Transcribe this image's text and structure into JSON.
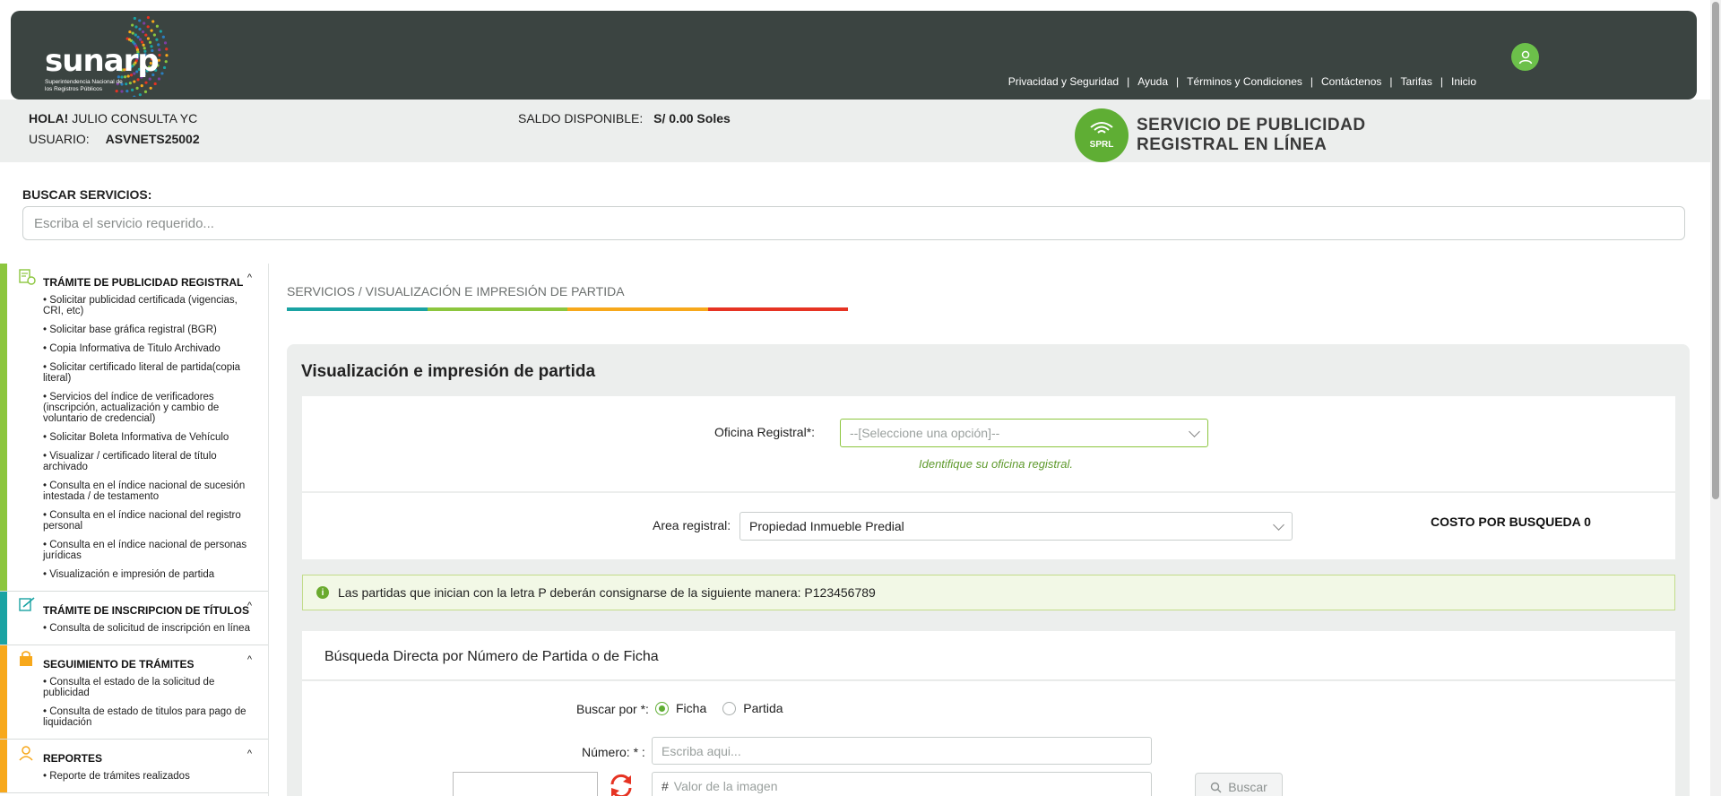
{
  "header": {
    "logo_text": "sunarp",
    "logo_subtitle": "Superintendencia Nacional de los Registros Públicos",
    "nav": [
      "Privacidad y Seguridad",
      "Ayuda",
      "Términos y Condiciones",
      "Contáctenos",
      "Tarifas",
      "Inicio"
    ],
    "nav_separator": "|"
  },
  "user": {
    "greeting_label": "HOLA!",
    "greeting_name": "JULIO CONSULTA YC",
    "user_label": "USUARIO:",
    "user_value": "ASVNETS25002",
    "saldo_label": "SALDO DISPONIBLE:",
    "saldo_value": "S/ 0.00 Soles"
  },
  "service_banner": {
    "badge": "SPRL",
    "title": "SERVICIO DE PUBLICIDAD REGISTRAL EN LÍNEA"
  },
  "search": {
    "label": "BUSCAR SERVICIOS:",
    "placeholder": "Escriba el servicio requerido..."
  },
  "sidebar": {
    "sections": [
      {
        "title": "TRÁMITE DE PUBLICIDAD REGISTRAL",
        "color": "#8cc63e",
        "items": [
          "• Solicitar publicidad certificada (vigencias, CRI, etc)",
          "• Solicitar base gráfica registral (BGR)",
          "• Copia Informativa de Titulo Archivado",
          "• Solicitar certificado literal de partida(copia literal)",
          "• Servicios del índice de verificadores (inscripción, actualización y cambio de voluntario de credencial)",
          "• Solicitar Boleta Informativa de Vehículo",
          "• Visualizar / certificado literal de título archivado",
          "• Consulta en el índice nacional de sucesión intestada / de testamento",
          "• Consulta en el índice nacional del registro personal",
          "• Consulta en el índice nacional de personas jurídicas",
          "• Visualización e impresión de partida"
        ]
      },
      {
        "title": "TRÁMITE DE INSCRIPCION DE TÍTULOS",
        "color": "#1aa3a3",
        "items": [
          "• Consulta de solicitud de inscripción en línea"
        ]
      },
      {
        "title": "SEGUIMIENTO DE TRÁMITES",
        "color": "#f7a81b",
        "items": [
          "• Consulta el estado de la solicitud de publicidad",
          "• Consulta de estado de titulos para pago de liquidación"
        ]
      },
      {
        "title": "REPORTES",
        "color": "#f7a81b",
        "items": [
          "• Reporte de trámites realizados"
        ]
      }
    ]
  },
  "breadcrumb": "SERVICIOS / VISUALIZACIÓN E IMPRESIÓN DE PARTIDA",
  "breadcrumb_colors": [
    "#1aa3a3",
    "#8cc63e",
    "#f7a81b",
    "#e63323"
  ],
  "main": {
    "title": "Visualización e impresión de partida",
    "oficina_label": "Oficina Registral*:",
    "oficina_placeholder": "--[Seleccione una opción]--",
    "oficina_hint": "Identifique su oficina registral.",
    "area_label": "Area registral:",
    "area_value": "Propiedad Inmueble Predial",
    "costo_label": "COSTO POR BUSQUEDA 0",
    "alert_text": "Las partidas que inician con la letra P deberán consignarse de la siguiente manera: P123456789",
    "section_title": "Búsqueda Directa por Número de Partida o de Ficha",
    "buscar_por_label": "Buscar por *:",
    "radio_options": [
      "Ficha",
      "Partida"
    ],
    "radio_selected": "Ficha",
    "numero_label": "Número: * :",
    "numero_placeholder": "Escriba aqui...",
    "captcha_placeholder": "Valor de la imagen",
    "buscar_button": "Buscar"
  },
  "colors": {
    "header_bg": "#3b4441",
    "accent_green": "#5fae34",
    "info_bg": "#eceeed"
  }
}
